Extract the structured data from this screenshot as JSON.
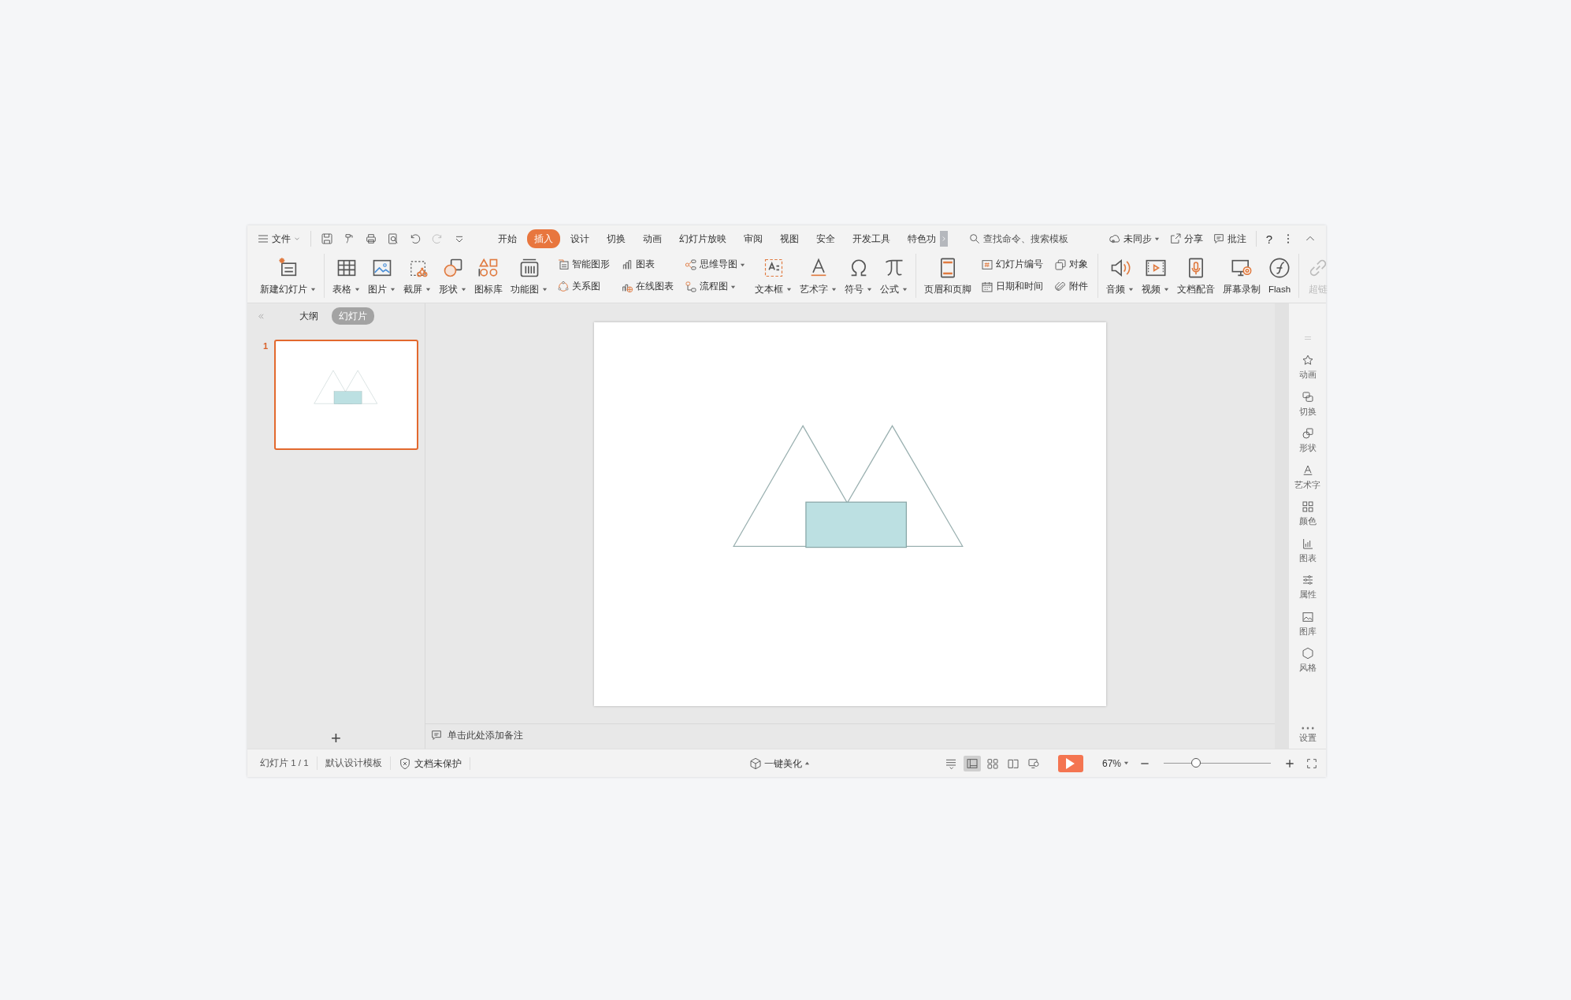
{
  "title_bar": {
    "file_menu": "文件",
    "tabs": [
      {
        "label": "开始",
        "selected": false
      },
      {
        "label": "插入",
        "selected": true
      },
      {
        "label": "设计",
        "selected": false
      },
      {
        "label": "切换",
        "selected": false
      },
      {
        "label": "动画",
        "selected": false
      },
      {
        "label": "幻灯片放映",
        "selected": false
      },
      {
        "label": "审阅",
        "selected": false
      },
      {
        "label": "视图",
        "selected": false
      },
      {
        "label": "安全",
        "selected": false
      },
      {
        "label": "开发工具",
        "selected": false
      },
      {
        "label": "特色功",
        "selected": false
      }
    ],
    "search_placeholder": "查找命令、搜索模板",
    "sync": "未同步",
    "share": "分享",
    "comment": "批注",
    "help": "?"
  },
  "ribbon": {
    "groups": [
      [
        {
          "kind": "large",
          "label": "新建幻灯片",
          "dropdown": true,
          "disabled": false
        }
      ],
      [
        {
          "kind": "large",
          "label": "表格",
          "dropdown": true,
          "disabled": false
        },
        {
          "kind": "large",
          "label": "图片",
          "dropdown": true,
          "disabled": false
        },
        {
          "kind": "large",
          "label": "截屏",
          "dropdown": true,
          "disabled": false
        },
        {
          "kind": "large",
          "label": "形状",
          "dropdown": true,
          "disabled": false
        },
        {
          "kind": "large",
          "label": "图标库",
          "dropdown": false,
          "disabled": false
        },
        {
          "kind": "large",
          "label": "功能图",
          "dropdown": true,
          "disabled": false
        },
        {
          "kind": "stack",
          "items": [
            {
              "label": "智能图形",
              "dropdown": false
            },
            {
              "label": "关系图",
              "dropdown": false
            }
          ]
        },
        {
          "kind": "stack",
          "items": [
            {
              "label": "图表",
              "dropdown": false
            },
            {
              "label": "在线图表",
              "dropdown": false
            }
          ]
        },
        {
          "kind": "stack",
          "items": [
            {
              "label": "思维导图",
              "dropdown": true
            },
            {
              "label": "流程图",
              "dropdown": true
            }
          ]
        },
        {
          "kind": "large",
          "label": "文本框",
          "dropdown": true,
          "disabled": false
        },
        {
          "kind": "large",
          "label": "艺术字",
          "dropdown": true,
          "disabled": false
        },
        {
          "kind": "large",
          "label": "符号",
          "dropdown": true,
          "disabled": false
        },
        {
          "kind": "large",
          "label": "公式",
          "dropdown": true,
          "disabled": false
        }
      ],
      [
        {
          "kind": "large",
          "label": "页眉和页脚",
          "dropdown": false,
          "disabled": false
        },
        {
          "kind": "stack",
          "items": [
            {
              "label": "幻灯片编号",
              "dropdown": false
            },
            {
              "label": "日期和时间",
              "dropdown": false
            }
          ]
        },
        {
          "kind": "stack",
          "items": [
            {
              "label": "对象",
              "dropdown": false
            },
            {
              "label": "附件",
              "dropdown": false
            }
          ]
        }
      ],
      [
        {
          "kind": "large",
          "label": "音频",
          "dropdown": true,
          "disabled": false
        },
        {
          "kind": "large",
          "label": "视频",
          "dropdown": true,
          "disabled": false
        },
        {
          "kind": "large",
          "label": "文档配音",
          "dropdown": false,
          "disabled": false
        },
        {
          "kind": "large",
          "label": "屏幕录制",
          "dropdown": false,
          "disabled": false
        },
        {
          "kind": "large",
          "label": "Flash",
          "dropdown": false,
          "disabled": false
        }
      ],
      [
        {
          "kind": "large",
          "label": "超链",
          "dropdown": false,
          "disabled": true
        }
      ]
    ]
  },
  "left_panel": {
    "tabs": [
      {
        "label": "大纲",
        "selected": false
      },
      {
        "label": "幻灯片",
        "selected": true
      }
    ],
    "slides": [
      {
        "number": "1",
        "selected": true
      }
    ],
    "add": "+"
  },
  "notes_placeholder": "单击此处添加备注",
  "right_sidebar": [
    "动画",
    "切换",
    "形状",
    "艺术字",
    "颜色",
    "图表",
    "属性",
    "图库",
    "风格",
    "设置"
  ],
  "status_bar": {
    "slide_count": "幻灯片 1 / 1",
    "template": "默认设计模板",
    "protection": "文档未保护",
    "beautify": "一键美化",
    "views": [
      {
        "selected": true
      },
      {
        "selected": false
      },
      {
        "selected": false
      },
      {
        "selected": false
      }
    ],
    "zoom": "67%",
    "zoom_slider": {
      "level": 0.3
    }
  }
}
